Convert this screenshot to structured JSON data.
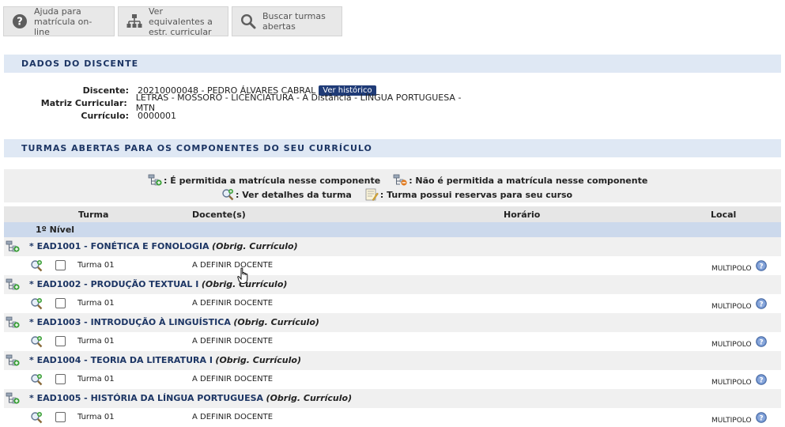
{
  "toolbar": {
    "help": "Ajuda para\nmatrícula on-line",
    "equivalents": "Ver equivalentes a\nestr. curricular",
    "search": "Buscar turmas\nabertas"
  },
  "student_section": {
    "title": "DADOS DO DISCENTE",
    "discente_label": "Discente:",
    "discente_value": "20210000048 - PEDRO ÁLVARES CABRAL",
    "historico_button": "Ver histórico",
    "matriz_label": "Matriz Curricular:",
    "matriz_value": "LETRAS - MOSSORÓ - LICENCIATURA - A Distância - LÍNGUA PORTUGUESA - MTN",
    "curriculo_label": "Currículo:",
    "curriculo_value": "0000001"
  },
  "classes_section": {
    "title": "TURMAS ABERTAS PARA OS COMPONENTES DO SEU CURRÍCULO"
  },
  "legend": {
    "allowed": ": É permitida a matrícula nesse componente",
    "not_allowed": ": Não é permitida a matrícula nesse componente",
    "details": ": Ver detalhes da turma",
    "reserves": ": Turma possui reservas para seu curso"
  },
  "table": {
    "headers": {
      "turma": "Turma",
      "docente": "Docente(s)",
      "horario": "Horário",
      "local": "Local"
    },
    "level": "1º Nível",
    "components": [
      {
        "code": "* EAD1001 - FONÉTICA E FONOLOGIA",
        "type": "(Obrig. Currículo)",
        "turma": "Turma 01",
        "docente": "A DEFINIR DOCENTE",
        "local": "MULTIPOLO"
      },
      {
        "code": "* EAD1002 - PRODUÇÃO TEXTUAL I",
        "type": "(Obrig. Currículo)",
        "turma": "Turma 01",
        "docente": "A DEFINIR DOCENTE",
        "local": "MULTIPOLO"
      },
      {
        "code": "* EAD1003 - INTRODUÇÃO À LINGUÍSTICA",
        "type": "(Obrig. Currículo)",
        "turma": "Turma 01",
        "docente": "A DEFINIR DOCENTE",
        "local": "MULTIPOLO"
      },
      {
        "code": "* EAD1004 - TEORIA DA LITERATURA I",
        "type": "(Obrig. Currículo)",
        "turma": "Turma 01",
        "docente": "A DEFINIR DOCENTE",
        "local": "MULTIPOLO"
      },
      {
        "code": "* EAD1005 - HISTÓRIA DA LÍNGUA PORTUGUESA",
        "type": "(Obrig. Currículo)",
        "turma": "Turma 01",
        "docente": "A DEFINIR DOCENTE",
        "local": "MULTIPOLO"
      }
    ]
  },
  "icons": {
    "help": "question-circle-icon",
    "equivalents": "hierarchy-icon",
    "search": "magnifier-icon",
    "enroll_allowed": "tree-plus-icon",
    "enroll_not_allowed": "tree-block-icon",
    "details": "magnifier-plus-icon",
    "reserves": "notepad-icon",
    "local_help": "help-bubble-icon"
  },
  "colors": {
    "section_bg": "#dfe8f4",
    "section_text": "#1c3564",
    "level_bg": "#ccd9ec",
    "button_dark": "#1f3b77"
  }
}
